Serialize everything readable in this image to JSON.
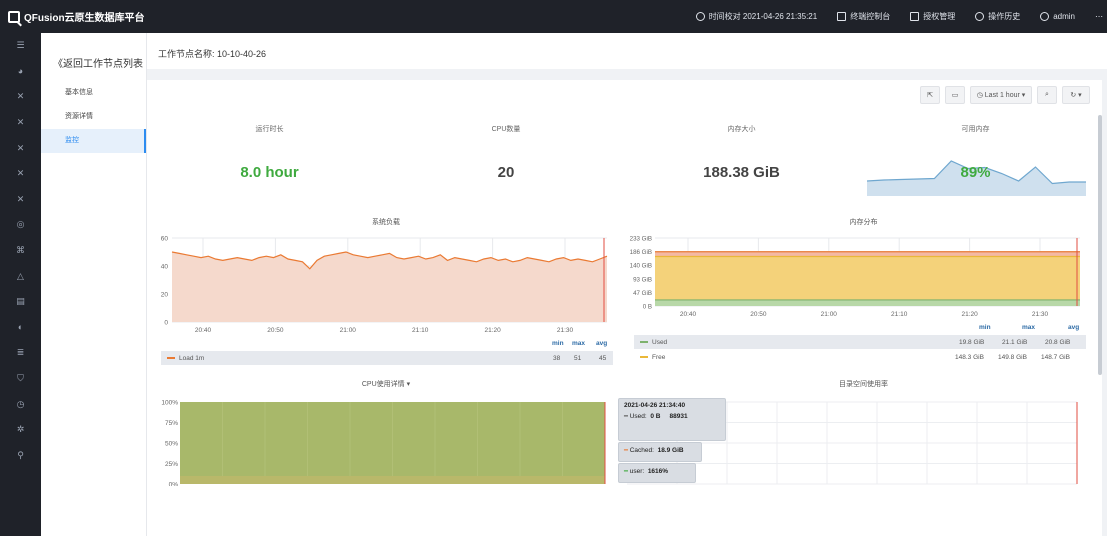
{
  "app": {
    "title": "QFusion云原生数据库平台"
  },
  "topnav": [
    {
      "label": "时间校对 2021-04-26 21:35:21",
      "icon": "clock-icon"
    },
    {
      "label": "终端控制台",
      "icon": "terminal-icon"
    },
    {
      "label": "授权管理",
      "icon": "license-icon"
    },
    {
      "label": "操作历史",
      "icon": "history-icon"
    },
    {
      "label": "admin",
      "icon": "user-icon"
    }
  ],
  "rail": [
    "menu-icon",
    "dashboard-icon",
    "cluster-icon",
    "cluster-icon",
    "cluster-icon",
    "cluster-icon",
    "cluster-icon",
    "target-icon",
    "node-icon",
    "alert-icon",
    "document-icon",
    "palette-icon",
    "list-icon",
    "shield-icon",
    "backup-icon",
    "settings-icon",
    "location-icon"
  ],
  "subnav": {
    "back": "《返回工作节点列表",
    "items": [
      "基本信息",
      "资源详情",
      "监控"
    ],
    "active": 2
  },
  "page": {
    "node_label": "工作节点名称: 10-10-40-26"
  },
  "toolbar": {
    "time_range": "Last 1 hour"
  },
  "stats": {
    "uptime": {
      "label": "运行时长",
      "value": "8.0 hour",
      "color": "#3faa3f"
    },
    "cpu": {
      "label": "CPU数量",
      "value": "20",
      "color": "#444444"
    },
    "mem": {
      "label": "内存大小",
      "value": "188.38 GiB",
      "color": "#444444"
    },
    "avail": {
      "label": "可用内存",
      "value": "89%",
      "color": "#3faa3f"
    }
  },
  "load_panel": {
    "title": "系统负载",
    "yticks": [
      "60",
      "40",
      "20",
      "0"
    ],
    "xticks": [
      "20:40",
      "20:50",
      "21:00",
      "21:10",
      "21:20",
      "21:30"
    ],
    "legend": {
      "name": "Load 1m",
      "min": "38",
      "max": "51",
      "avg": "45",
      "color": "#ea7a33"
    },
    "headers": {
      "min": "min",
      "max": "max",
      "avg": "avg"
    }
  },
  "mem_panel": {
    "title": "内存分布",
    "yticks": [
      "233 GiB",
      "186 GiB",
      "140 GiB",
      "93 GiB",
      "47 GiB",
      "0 B"
    ],
    "xticks": [
      "20:40",
      "20:50",
      "21:00",
      "21:10",
      "21:20",
      "21:30"
    ],
    "headers": {
      "min": "min",
      "max": "max",
      "avg": "avg"
    },
    "legend": [
      {
        "name": "Used",
        "min": "19.8 GiB",
        "max": "21.1 GiB",
        "avg": "20.8 GiB",
        "color": "#7eb26d"
      },
      {
        "name": "Free",
        "min": "148.3 GiB",
        "max": "149.8 GiB",
        "avg": "148.7 GiB",
        "color": "#eab839"
      }
    ]
  },
  "cpu_panel": {
    "title": "CPU使用详情 ▾",
    "yticks": [
      "100%",
      "75%",
      "50%",
      "25%",
      "0%"
    ]
  },
  "disk_panel": {
    "title": "目录空间使用率"
  },
  "tooltip": {
    "time": "2021-04-26 21:34:40",
    "rows": [
      {
        "label": "Used:",
        "value": "0 B",
        "extra": "88931",
        "color": "#555555"
      },
      {
        "label": "Cached:",
        "value": "18.9 GiB",
        "color": "#ea7a33"
      },
      {
        "label": "user:",
        "value": "1616%",
        "color": "#3faa3f"
      }
    ]
  },
  "chart_data": [
    {
      "type": "area",
      "title": "系统负载",
      "series": [
        {
          "name": "Load 1m",
          "values": [
            50,
            49,
            48,
            47,
            46,
            47,
            45,
            44,
            45,
            46,
            45,
            44,
            46,
            47,
            46,
            48,
            45,
            44,
            43,
            38,
            44,
            47,
            48,
            49,
            50,
            48,
            47,
            46,
            47,
            48,
            49,
            46,
            45,
            46,
            47,
            45,
            46,
            48,
            44,
            46,
            45,
            44,
            43,
            45,
            46,
            44,
            45,
            43,
            44,
            46,
            45,
            44,
            43,
            45,
            46,
            44,
            45,
            44,
            43,
            45,
            47
          ]
        }
      ],
      "ylim": [
        0,
        60
      ]
    },
    {
      "type": "area",
      "title": "内存分布",
      "series": [
        {
          "name": "Used",
          "values": [
            20.8,
            20.8,
            20.8,
            20.8,
            20.8,
            20.8
          ]
        },
        {
          "name": "Free",
          "values": [
            148.7,
            148.7,
            148.7,
            148.7,
            148.7,
            148.7
          ]
        }
      ],
      "ylim": [
        0,
        233
      ]
    },
    {
      "type": "area",
      "title": "可用内存",
      "values": [
        30,
        32,
        33,
        34,
        35,
        70,
        55,
        57,
        45,
        30,
        58,
        25,
        28,
        28
      ],
      "ylim": [
        0,
        100
      ]
    }
  ]
}
